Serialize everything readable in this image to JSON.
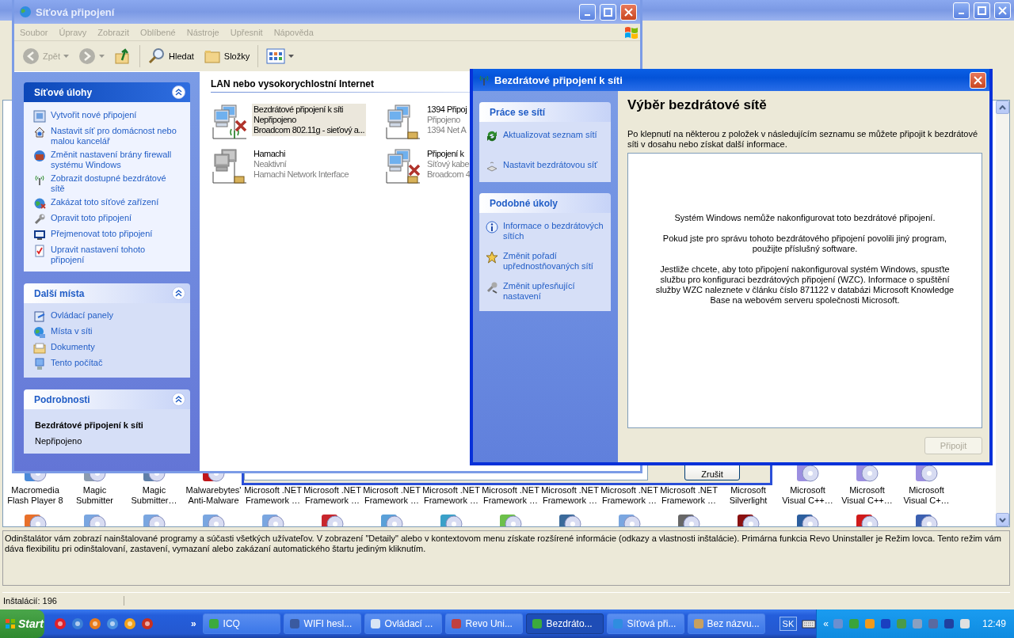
{
  "revo_window": {
    "program_icons": [
      {
        "lines": [
          "Macromedia",
          "Flash Player 8"
        ]
      },
      {
        "lines": [
          "Magic",
          "Submitter"
        ]
      },
      {
        "lines": [
          "Magic",
          "Submitter…"
        ]
      },
      {
        "lines": [
          "Malwarebytes'",
          "Anti-Malware"
        ]
      },
      {
        "lines": [
          "Microsoft .NET",
          "Framework …"
        ]
      },
      {
        "lines": [
          "Microsoft .NET",
          "Framework …"
        ]
      },
      {
        "lines": [
          "Microsoft .NET",
          "Framework …"
        ]
      },
      {
        "lines": [
          "Microsoft .NET",
          "Framework …"
        ]
      },
      {
        "lines": [
          "Microsoft .NET",
          "Framework …"
        ]
      },
      {
        "lines": [
          "Microsoft .NET",
          "Framework …"
        ]
      },
      {
        "lines": [
          "Microsoft .NET",
          "Framework …"
        ]
      },
      {
        "lines": [
          "Microsoft .NET",
          "Framework …"
        ]
      },
      {
        "lines": [
          "Microsoft",
          "Silverlight"
        ]
      },
      {
        "lines": [
          "Microsoft",
          "Visual C++…"
        ]
      },
      {
        "lines": [
          "Microsoft",
          "Visual C++…"
        ]
      },
      {
        "lines": [
          "Microsoft",
          "Visual C+…"
        ]
      }
    ],
    "description": "Odinštalátor vám zobrazí nainštalované programy a súčasti všetkých užívateľov. V zobrazení \"Detaily\" alebo v kontextovom menu získate rozšírené informácie (odkazy a vlastnosti inštalácie). Primárna funkcia Revo Uninstaller je Režim lovca. Tento režim vám dáva flexibilitu pri odinštalovaní, zastavení, vymazaní alebo zakázaní automatického štartu jediným kliknutím.",
    "status": "Inštalácií: 196"
  },
  "background_dialog": {
    "button": "Zrušit"
  },
  "network_window": {
    "title": "Síťová připojení",
    "menu": [
      "Soubor",
      "Úpravy",
      "Zobrazit",
      "Oblíbené",
      "Nástroje",
      "Upřesnit",
      "Nápověda"
    ],
    "toolbar": [
      {
        "kind": "back",
        "label": "Zpět",
        "disabled": true
      },
      {
        "kind": "forward",
        "disabled": true
      },
      {
        "kind": "up",
        "disabled": false
      },
      {
        "kind": "search",
        "label": "Hledat",
        "disabled": false
      },
      {
        "kind": "folders",
        "label": "Složky",
        "disabled": false
      },
      {
        "kind": "views",
        "disabled": false
      }
    ],
    "task_pane": [
      {
        "kind": "primary",
        "title": "Síťové úlohy",
        "expanded": true,
        "items": [
          "Vytvořit nové připojení",
          "Nastavit síť pro domácnost nebo malou kancelář",
          "Změnit nastavení brány firewall systému Windows",
          "Zobrazit dostupné bezdrátové sítě",
          "Zakázat toto síťové zařízení",
          "Opravit toto připojení",
          "Přejmenovat toto připojení",
          "Upravit nastavení tohoto připojení"
        ]
      },
      {
        "kind": "links",
        "title": "Další místa",
        "expanded": true,
        "items": [
          "Ovládací panely",
          "Místa v síti",
          "Dokumenty",
          "Tento počítač"
        ]
      },
      {
        "kind": "details",
        "title": "Podrobnosti",
        "expanded": true,
        "name": "Bezdrátové připojení k síti",
        "status": "Nepřipojeno"
      }
    ],
    "section_title": "LAN nebo vysokorychlostní Internet",
    "connections": [
      {
        "kind": "wireless",
        "name": "Bezdrátové připojení k síti",
        "status": "Nepřipojeno",
        "device": "Broadcom 802.11g - sieťový a...",
        "disconnected": true,
        "disabled": false,
        "selected": true
      },
      {
        "kind": "wired",
        "name": "1394 Připoj",
        "status": "Připojeno",
        "device": "1394 Net A",
        "disconnected": false,
        "disabled": false,
        "selected": false
      },
      {
        "kind": "wired",
        "name": "Hamachi",
        "status": "Neaktivní",
        "device": "Hamachi Network Interface",
        "disconnected": false,
        "disabled": true,
        "selected": false
      },
      {
        "kind": "wired",
        "name": "Připojení k",
        "status": "Síťový kabe",
        "device": "Broadcom 4",
        "disconnected": true,
        "disabled": false,
        "selected": false
      }
    ]
  },
  "wireless_dialog": {
    "title": "Bezdrátové připojení k síti",
    "panels": [
      {
        "title": "Práce se sítí",
        "items": [
          "Aktualizovat seznam sítí",
          "Nastavit bezdrátovou síť"
        ]
      },
      {
        "title": "Podobné úkoly",
        "items": [
          "Informace o bezdrátových sítích",
          "Změnit pořadí upřednostňovaných sítí",
          "Změnit upřesňující nastavení"
        ]
      }
    ],
    "heading": "Výběr bezdrátové sítě",
    "intro": "Po klepnutí na některou z položek v následujícím seznamu se můžete připojit k bezdrátové síti v dosahu nebo získat další informace.",
    "messages": [
      "Systém Windows nemůže nakonfigurovat toto bezdrátové připojení.",
      "Pokud jste pro správu tohoto bezdrátového připojení povolili jiný program, použijte příslušný software.",
      "Jestliže chcete, aby toto připojení nakonfiguroval systém Windows, spusťte službu pro konfiguraci bezdrátových připojení (WZC). Informace o spuštění služby WZC naleznete v článku číslo 871122 v databázi Microsoft Knowledge Base na webovém serveru společnosti Microsoft."
    ],
    "connect_button": {
      "label": "Připojit",
      "disabled": true
    }
  },
  "taskbar": {
    "start": "Start",
    "overflow": "»",
    "tasks": [
      {
        "label": "ICQ",
        "selected": false
      },
      {
        "label": "WIFI hesl...",
        "selected": false
      },
      {
        "label": "Ovládací ...",
        "selected": false
      },
      {
        "label": "Revo Uni...",
        "selected": false
      },
      {
        "label": "Bezdráto...",
        "selected": true
      },
      {
        "label": "Síťová při...",
        "selected": false
      },
      {
        "label": "Bez názvu...",
        "selected": false
      }
    ],
    "language": "SK",
    "tray_overflow": "«",
    "clock": "12:49"
  }
}
